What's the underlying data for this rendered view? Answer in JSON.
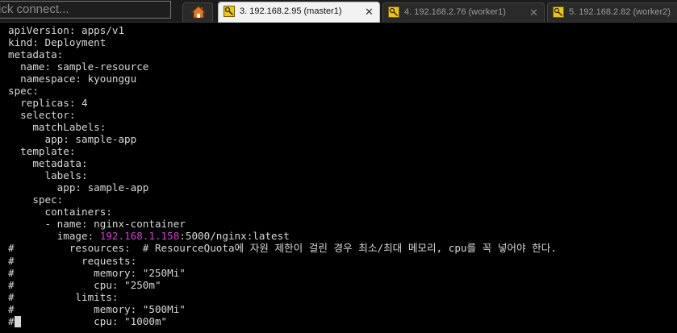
{
  "quick_connect": {
    "placeholder": "ick connect..."
  },
  "tabs": [
    {
      "label": "3. 192.168.2.95 (master1)",
      "active": true
    },
    {
      "label": "4. 192.168.2.76 (worker1)",
      "active": false
    },
    {
      "label": "5. 192.168.2.82 (worker2)",
      "active": false
    }
  ],
  "tab_close_glyph": "✕",
  "icons": {
    "home": "home-icon",
    "session": "key-icon",
    "close": "close-icon"
  },
  "colors": {
    "accent_magenta": "#d63cd6",
    "terminal_bg": "#000000",
    "terminal_fg": "#d8d8d8",
    "key_yellow": "#e8c520"
  },
  "terminal": {
    "lines": [
      "apiVersion: apps/v1",
      "kind: Deployment",
      "metadata:",
      "  name: sample-resource",
      "  namespace: kyounggu",
      "spec:",
      "  replicas: 4",
      "  selector:",
      "    matchLabels:",
      "      app: sample-app",
      "  template:",
      "    metadata:",
      "      labels:",
      "        app: sample-app",
      "    spec:",
      "      containers:",
      "      - name: nginx-container",
      "        image: "
    ],
    "image_ip": "192.168.1.158",
    "image_rest": ":5000/nginx:latest",
    "comment_lines": [
      "#         resources:  # ResourceQuota에 자원 제한이 걸린 경우 최소/최대 메모리, cpu를 꼭 넣어야 한다.",
      "#           requests:",
      "#             memory: \"250Mi\"",
      "#             cpu: \"250m\"",
      "#          limits:",
      "#             memory: \"500Mi\"",
      "#             cpu: \"1000m\""
    ]
  }
}
